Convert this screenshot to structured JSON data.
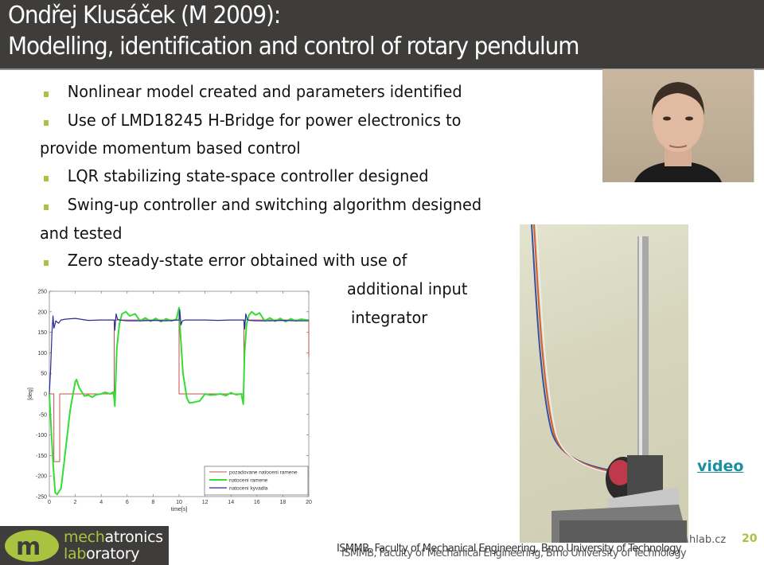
{
  "slide": {
    "title_line1": "Ondřej Klusáček (M 2009):",
    "title_line2": "Modelling, identification and control of rotary pendulum",
    "bullets": [
      {
        "text": "Nonlinear model created and  parameters identified"
      },
      {
        "text": "Use of LMD18245 H-Bridge for power electronics to",
        "continuation": "provide momentum based control"
      },
      {
        "text": "LQR stabilizing state-space controller designed"
      },
      {
        "text": "Swing-up controller and switching algorithm designed",
        "continuation": "and tested"
      },
      {
        "text": "Zero steady-state error obtained with use of",
        "continuation": "additional input",
        "continuation2": "integrator"
      }
    ],
    "video_link": "video",
    "photo_face_alt": "portrait photo of student",
    "photo_pendulum_alt": "rotary pendulum hardware photo",
    "accent_color": "#a9c23f",
    "link_color": "#1a8fa0"
  },
  "footer": {
    "logo_line1_accent": "mech",
    "logo_line1_rest": "atronics",
    "logo_line2_accent": "lab",
    "logo_line2_rest": "oratory",
    "institution": "ISMMB, Faculty of Mechanical Engineering, Brno University of Technology",
    "institution_shadow": "ISMMB, Faculty of Mechanical Engineering, Brno University of Technology",
    "url_fragment": "hlab.cz",
    "page_number": "20"
  },
  "chart_data": {
    "type": "line",
    "title": "",
    "xlabel": "time[s]",
    "ylabel": "[deg]",
    "xlim": [
      0,
      20
    ],
    "ylim": [
      -250,
      250
    ],
    "xticks": [
      0,
      2,
      4,
      6,
      8,
      10,
      12,
      14,
      16,
      18,
      20
    ],
    "yticks": [
      250,
      200,
      150,
      100,
      50,
      0,
      -50,
      -100,
      -150,
      -200,
      -250
    ],
    "grid": false,
    "legend_position": "bottom-right",
    "series": [
      {
        "name": "pozadovane natoceni ramene",
        "color": "#c0504d",
        "x": [
          0,
          0.35,
          0.35,
          0.8,
          0.8,
          5.0,
          5.0,
          10.0,
          10.0,
          15.0,
          15.0,
          20.0,
          20.0
        ],
        "y": [
          0,
          0,
          -165,
          -165,
          0,
          0,
          180,
          180,
          0,
          0,
          180,
          180,
          90
        ]
      },
      {
        "name": "natoceni ramene",
        "color": "#33dd33",
        "x": [
          0,
          0.1,
          0.3,
          0.45,
          0.6,
          0.8,
          0.9,
          1.2,
          1.6,
          2.0,
          2.1,
          2.3,
          2.7,
          3.0,
          3.3,
          3.6,
          4.0,
          4.3,
          4.7,
          4.95,
          5.05,
          5.2,
          5.4,
          5.6,
          5.9,
          6.2,
          6.6,
          7.0,
          7.4,
          7.8,
          8.2,
          8.6,
          9.0,
          9.4,
          9.8,
          10.0,
          10.1,
          10.3,
          10.6,
          10.8,
          11.2,
          11.6,
          12.0,
          12.4,
          12.8,
          13.2,
          13.6,
          14.0,
          14.4,
          14.8,
          14.95,
          15.05,
          15.2,
          15.4,
          15.6,
          15.9,
          16.2,
          16.6,
          17.0,
          17.4,
          17.8,
          18.2,
          18.6,
          19.0,
          19.4,
          19.8,
          20.0
        ],
        "y": [
          0,
          -60,
          -175,
          -240,
          -245,
          -235,
          -230,
          -150,
          -40,
          30,
          35,
          15,
          -5,
          -3,
          -8,
          -2,
          0,
          4,
          0,
          5,
          -30,
          110,
          170,
          195,
          200,
          190,
          195,
          178,
          185,
          177,
          184,
          176,
          183,
          178,
          182,
          210,
          150,
          50,
          -10,
          -22,
          -20,
          -17,
          0,
          -3,
          -2,
          0,
          -4,
          3,
          -2,
          0,
          -25,
          100,
          170,
          192,
          200,
          192,
          197,
          178,
          185,
          177,
          184,
          176,
          183,
          178,
          182,
          180,
          180
        ]
      },
      {
        "name": "natoceni kyvadla",
        "color": "#2a2a9a",
        "x": [
          0,
          0.1,
          0.2,
          0.28,
          0.35,
          0.4,
          0.5,
          0.7,
          0.9,
          1.2,
          2.0,
          3.0,
          4.0,
          5.0,
          5.05,
          5.15,
          5.25,
          5.4,
          6.0,
          7.0,
          8.0,
          9.0,
          10.0,
          10.05,
          10.15,
          10.25,
          10.5,
          11.0,
          12.0,
          13.0,
          14.0,
          15.0,
          15.05,
          15.15,
          15.25,
          15.4,
          16.0,
          17.0,
          18.0,
          19.0,
          20.0
        ],
        "y": [
          0,
          60,
          150,
          190,
          160,
          165,
          178,
          172,
          180,
          182,
          184,
          179,
          180,
          180,
          155,
          195,
          182,
          180,
          178,
          178,
          179,
          178,
          180,
          205,
          168,
          178,
          180,
          180,
          180,
          179,
          180,
          180,
          158,
          195,
          182,
          179,
          178,
          178,
          179,
          178,
          178
        ]
      }
    ]
  }
}
